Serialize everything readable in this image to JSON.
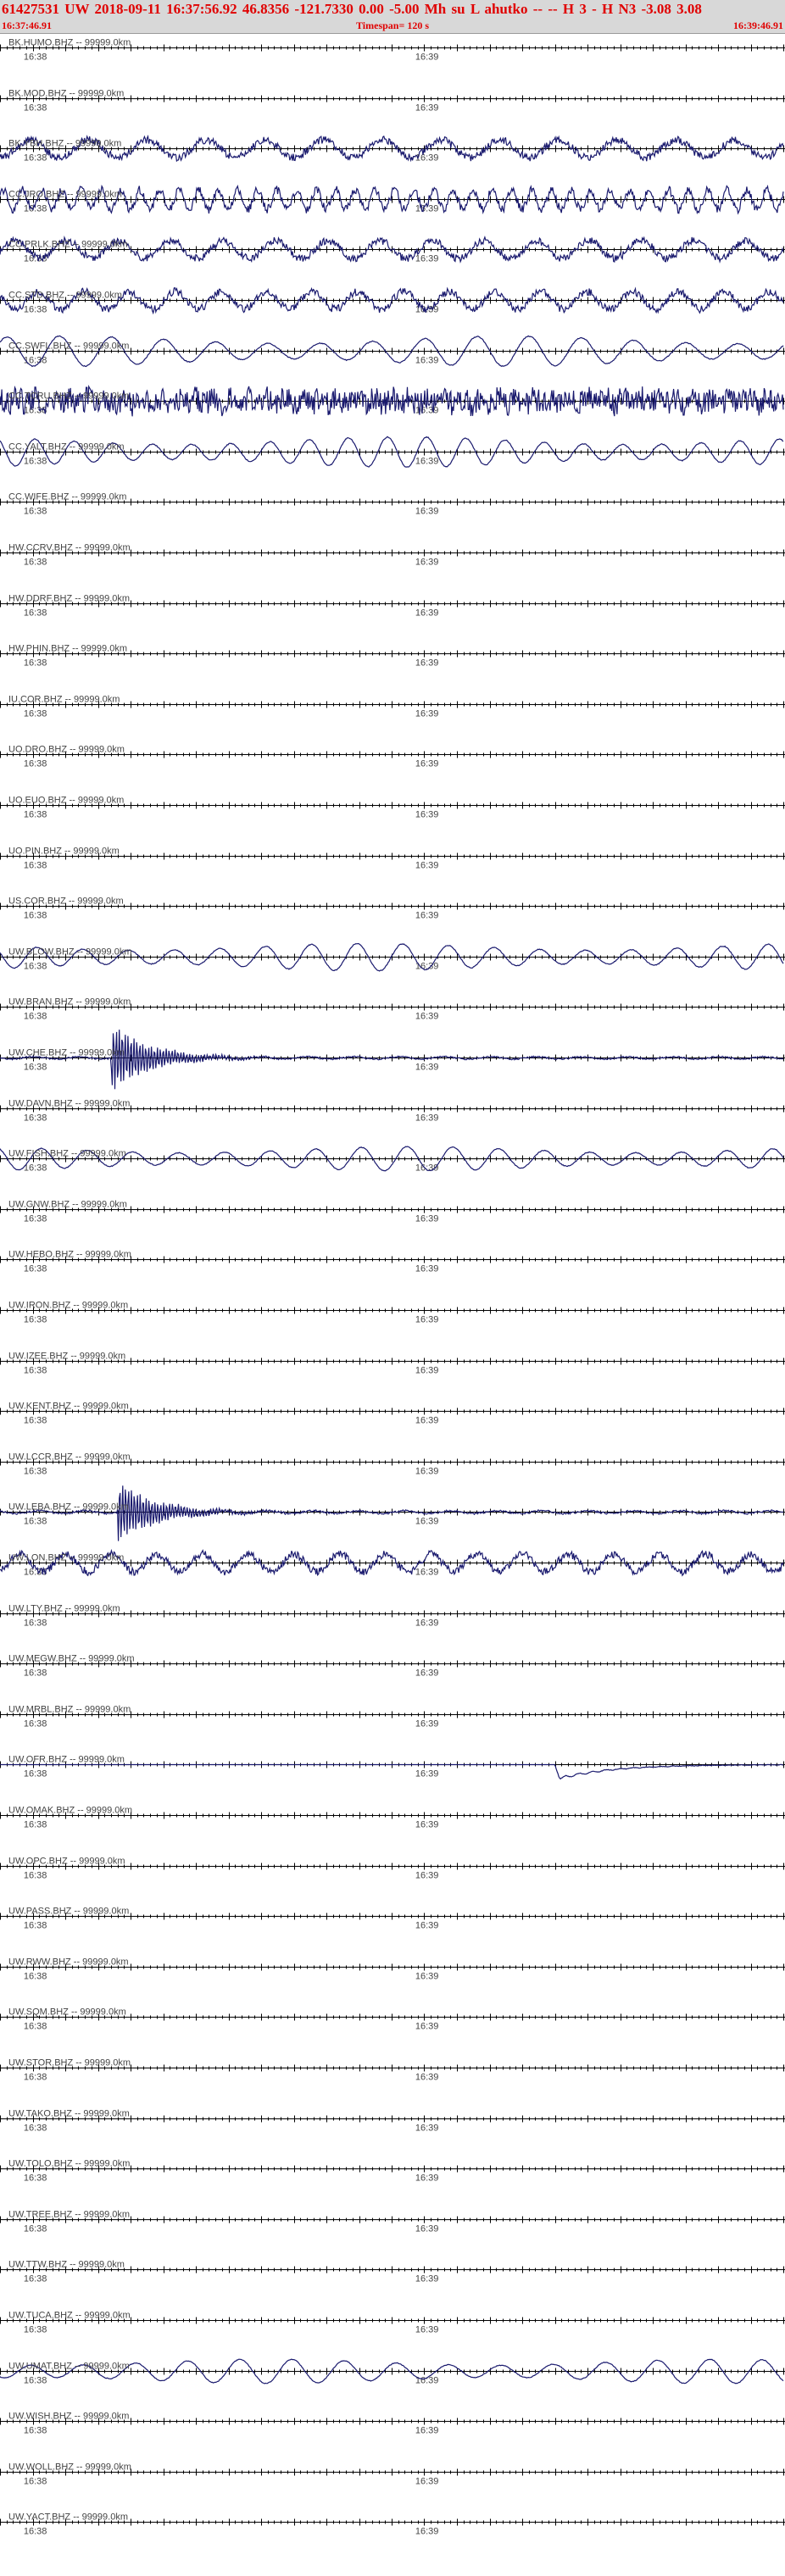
{
  "header": {
    "title": "61427531 UW 2018-09-11 16:37:56.92   46.8356  -121.7330   0.00  -5.00 Mh   su   L ahutko   -- --   H    3   -   H N3    -3.08   3.08",
    "start_time": "16:37:46.91",
    "end_time": "16:39:46.91",
    "timespan": "Timespan= 120 s"
  },
  "colors": {
    "header_text": "#e00000",
    "header_bg": "#d8d8d8",
    "trace": "#1a1a6e",
    "axis": "#000000",
    "label": "#444444"
  },
  "chart_data": {
    "type": "line",
    "title": "61427531 UW 2018-09-11 16:37:56.92",
    "x_unit": "s",
    "x_range": [
      0,
      120
    ],
    "time_labels": [
      "16:38",
      "16:39"
    ],
    "channels": [
      {
        "label": "BK.HUMO.BHZ -- 99999.0km",
        "signal": "none"
      },
      {
        "label": "BK.MOD.BHZ -- 99999.0km",
        "signal": "none"
      },
      {
        "label": "BK.YBH.BHZ -- 99999.0km",
        "signal": "noisy-wave",
        "amplitude": 0.9,
        "period_s": 9
      },
      {
        "label": "CC.JRO.BHZ -- 99999.0km",
        "signal": "noisy-wave",
        "amplitude": 1.0,
        "period_s": 3
      },
      {
        "label": "CC.PRLK.BHZ -- 99999.0km",
        "signal": "noisy-wave",
        "amplitude": 0.9,
        "period_s": 8
      },
      {
        "label": "CC.STD.BHZ -- 99999.0km",
        "signal": "noisy-wave",
        "amplitude": 0.9,
        "period_s": 7
      },
      {
        "label": "CC.SWFL.BHZ -- 99999.0km",
        "signal": "smooth-wave",
        "amplitude": 1.0,
        "period_s": 8
      },
      {
        "label": "CC.TCRU.BHZ -- 99999.0km",
        "signal": "broadband-noise",
        "amplitude": 1.0
      },
      {
        "label": "CC.YALT.BHZ -- 99999.0km",
        "signal": "smooth-wave",
        "amplitude": 1.0,
        "period_s": 6
      },
      {
        "label": "CC.WIFE.BHZ -- 99999.0km",
        "signal": "none"
      },
      {
        "label": "HW.CCRV.BHZ -- 99999.0km",
        "signal": "none"
      },
      {
        "label": "HW.DDRF.BHZ -- 99999.0km",
        "signal": "none"
      },
      {
        "label": "HW.PHIN.BHZ -- 99999.0km",
        "signal": "none"
      },
      {
        "label": "IU.COR.BHZ -- 99999.0km",
        "signal": "none"
      },
      {
        "label": "UO.DRO.BHZ -- 99999.0km",
        "signal": "none"
      },
      {
        "label": "UO.EUO.BHZ -- 99999.0km",
        "signal": "none"
      },
      {
        "label": "UO.PIN.BHZ -- 99999.0km",
        "signal": "none"
      },
      {
        "label": "US.COR.BHZ -- 99999.0km",
        "signal": "none"
      },
      {
        "label": "UW.BLOW.BHZ -- 99999.0km",
        "signal": "smooth-wave",
        "amplitude": 0.9,
        "period_s": 7
      },
      {
        "label": "UW.BRAN.BHZ -- 99999.0km",
        "signal": "none"
      },
      {
        "label": "UW.CHE.BHZ -- 99999.0km",
        "signal": "event",
        "amplitude": 0.25,
        "burst_at_s": 17,
        "burst_amplitude": 0.9
      },
      {
        "label": "UW.DAVN.BHZ -- 99999.0km",
        "signal": "none"
      },
      {
        "label": "UW.FISH.BHZ -- 99999.0km",
        "signal": "smooth-wave",
        "amplitude": 0.8,
        "period_s": 7
      },
      {
        "label": "UW.GNW.BHZ -- 99999.0km",
        "signal": "none"
      },
      {
        "label": "UW.HEBO.BHZ -- 99999.0km",
        "signal": "none"
      },
      {
        "label": "UW.IRON.BHZ -- 99999.0km",
        "signal": "none"
      },
      {
        "label": "UW.IZEE.BHZ -- 99999.0km",
        "signal": "none"
      },
      {
        "label": "UW.KENT.BHZ -- 99999.0km",
        "signal": "none"
      },
      {
        "label": "UW.LCCR.BHZ -- 99999.0km",
        "signal": "none"
      },
      {
        "label": "UW.LEBA.BHZ -- 99999.0km",
        "signal": "event",
        "amplitude": 0.3,
        "burst_at_s": 18,
        "burst_amplitude": 0.8
      },
      {
        "label": "UW.LON.BHZ -- 99999.0km",
        "signal": "noisy-wave",
        "amplitude": 0.9,
        "period_s": 7
      },
      {
        "label": "UW.LTY.BHZ -- 99999.0km",
        "signal": "none"
      },
      {
        "label": "UW.MEGW.BHZ -- 99999.0km",
        "signal": "none"
      },
      {
        "label": "UW.MRBL.BHZ -- 99999.0km",
        "signal": "none"
      },
      {
        "label": "UW.OFR.BHZ -- 99999.0km",
        "signal": "step",
        "amplitude": 1.0,
        "burst_at_s": 85
      },
      {
        "label": "UW.OMAK.BHZ -- 99999.0km",
        "signal": "none"
      },
      {
        "label": "UW.OPC.BHZ -- 99999.0km",
        "signal": "none"
      },
      {
        "label": "UW.PASS.BHZ -- 99999.0km",
        "signal": "none"
      },
      {
        "label": "UW.RWW.BHZ -- 99999.0km",
        "signal": "none"
      },
      {
        "label": "UW.SQM.BHZ -- 99999.0km",
        "signal": "none"
      },
      {
        "label": "UW.STOR.BHZ -- 99999.0km",
        "signal": "none"
      },
      {
        "label": "UW.TAKO.BHZ -- 99999.0km",
        "signal": "none"
      },
      {
        "label": "UW.TOLO.BHZ -- 99999.0km",
        "signal": "none"
      },
      {
        "label": "UW.TREE.BHZ -- 99999.0km",
        "signal": "none"
      },
      {
        "label": "UW.TTW.BHZ -- 99999.0km",
        "signal": "none"
      },
      {
        "label": "UW.TUCA.BHZ -- 99999.0km",
        "signal": "none"
      },
      {
        "label": "UW.UMAT.BHZ -- 99999.0km",
        "signal": "smooth-wave",
        "amplitude": 0.8,
        "period_s": 8
      },
      {
        "label": "UW.WISH.BHZ -- 99999.0km",
        "signal": "none"
      },
      {
        "label": "UW.WOLL.BHZ -- 99999.0km",
        "signal": "none"
      },
      {
        "label": "UW.YACT.BHZ -- 99999.0km",
        "signal": "none"
      }
    ]
  }
}
